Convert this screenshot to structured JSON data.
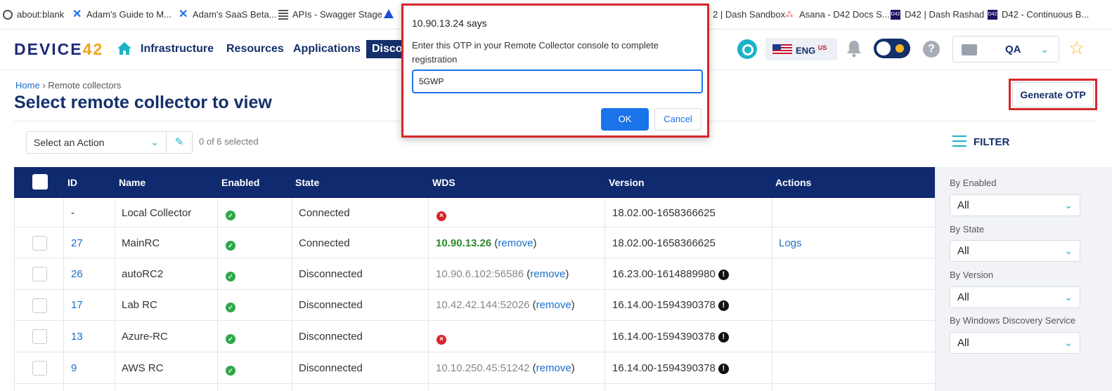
{
  "bookmarks": [
    {
      "label": "about:blank",
      "icon": "globe-icon"
    },
    {
      "label": "Adam's Guide to M...",
      "icon": "confluence-icon"
    },
    {
      "label": "Adam's SaaS Beta...",
      "icon": "confluence-icon"
    },
    {
      "label": "APIs - Swagger Stage",
      "icon": "document-icon"
    },
    {
      "label": "",
      "icon": "atlassian-icon"
    },
    {
      "label": "2 | Dash Sandbox",
      "icon": ""
    },
    {
      "label": "Asana - D42 Docs S...",
      "icon": "asana-icon"
    },
    {
      "label": "D42 | Dash Rashad",
      "icon": "d42-icon"
    },
    {
      "label": "D42 - Continuous B...",
      "icon": "d42-icon"
    }
  ],
  "nav": {
    "logo_main": "DEVICE",
    "logo_num": "42",
    "items": [
      "Infrastructure",
      "Resources",
      "Applications",
      "Disco"
    ],
    "lang_code": "ENG",
    "lang_region": "US",
    "help_glyph": "?",
    "workspace": "QA"
  },
  "breadcrumb": {
    "home": "Home",
    "separator": "›",
    "current": "Remote collectors"
  },
  "page_title": "Select remote collector to view",
  "generate_otp": "Generate OTP",
  "toolbar": {
    "action_placeholder": "Select an Action",
    "selected_count": "0 of 6 selected",
    "filter_label": "FILTER"
  },
  "table": {
    "headers": [
      "ID",
      "Name",
      "Enabled",
      "State",
      "WDS",
      "Version",
      "Actions"
    ],
    "remove_label": "remove",
    "rows": [
      {
        "id": "-",
        "name": "Local Collector",
        "state": "Connected",
        "wds": "",
        "wds_status": "error",
        "version": "18.02.00-1658366625",
        "version_warn": false,
        "action": "",
        "checkbox": false
      },
      {
        "id": "27",
        "name": "MainRC",
        "state": "Connected",
        "wds": "10.90.13.26",
        "wds_status": "ok",
        "version": "18.02.00-1658366625",
        "version_warn": false,
        "action": "Logs",
        "checkbox": true
      },
      {
        "id": "26",
        "name": "autoRC2",
        "state": "Disconnected",
        "wds": "10.90.6.102:56586",
        "wds_status": "grey",
        "version": "16.23.00-1614889980",
        "version_warn": true,
        "action": "",
        "checkbox": true
      },
      {
        "id": "17",
        "name": "Lab RC",
        "state": "Disconnected",
        "wds": "10.42.42.144:52026",
        "wds_status": "grey",
        "version": "16.14.00-1594390378",
        "version_warn": true,
        "action": "",
        "checkbox": true
      },
      {
        "id": "13",
        "name": "Azure-RC",
        "state": "Disconnected",
        "wds": "",
        "wds_status": "error",
        "version": "16.14.00-1594390378",
        "version_warn": true,
        "action": "",
        "checkbox": true
      },
      {
        "id": "9",
        "name": "AWS RC",
        "state": "Disconnected",
        "wds": "10.10.250.45:51242",
        "wds_status": "grey",
        "version": "16.14.00-1594390378",
        "version_warn": true,
        "action": "",
        "checkbox": true
      }
    ]
  },
  "filters": [
    {
      "label": "By Enabled",
      "value": "All"
    },
    {
      "label": "By State",
      "value": "All"
    },
    {
      "label": "By Version",
      "value": "All"
    },
    {
      "label": "By Windows Discovery Service",
      "value": "All"
    }
  ],
  "dialog": {
    "title": "10.90.13.24 says",
    "message": "Enter this OTP in your Remote Collector console to complete registration",
    "input_value": "5GWP",
    "ok": "OK",
    "cancel": "Cancel"
  },
  "colors": {
    "primary": "#0f2a6e",
    "accent": "#1ab3c7",
    "highlight": "#d8262b",
    "link": "#1a6fc9"
  }
}
